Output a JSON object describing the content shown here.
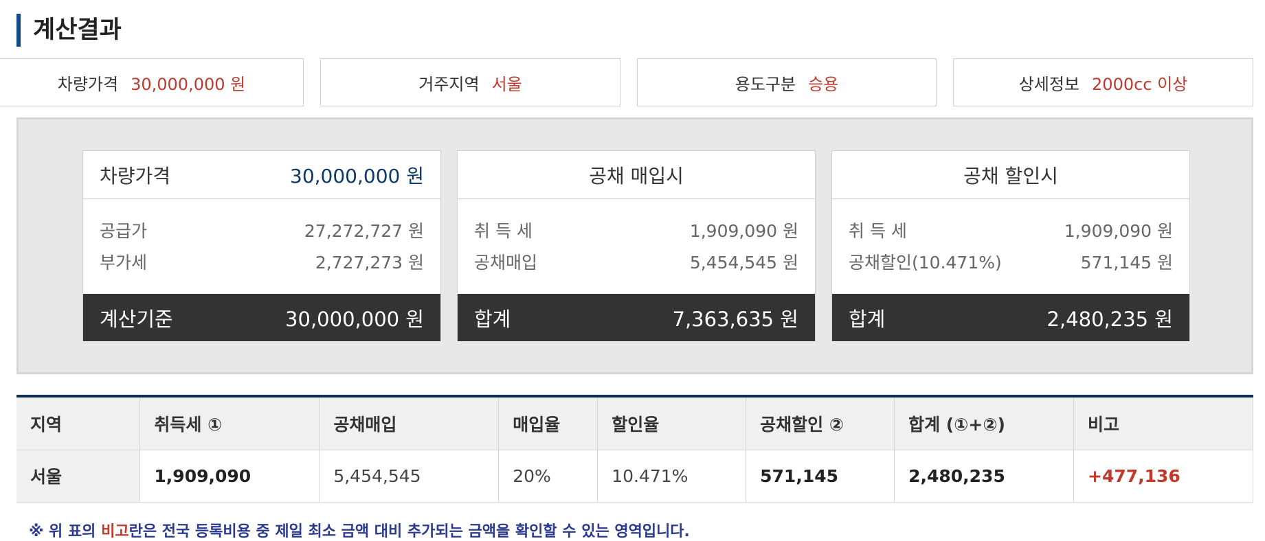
{
  "page": {
    "title": "계산결과"
  },
  "summary": [
    {
      "label": "차량가격",
      "value": "30,000,000 원"
    },
    {
      "label": "거주지역",
      "value": "서울"
    },
    {
      "label": "용도구분",
      "value": "승용"
    },
    {
      "label": "상세정보",
      "value": "2000cc 이상"
    }
  ],
  "cards": {
    "price": {
      "header_label": "차량가격",
      "header_value": "30,000,000 원",
      "lines": [
        {
          "label": "공급가",
          "value": "27,272,727 원"
        },
        {
          "label": "부가세",
          "value": "2,727,273 원"
        }
      ],
      "footer_label": "계산기준",
      "footer_value": "30,000,000 원"
    },
    "purchase": {
      "header_label": "공채 매입시",
      "lines": [
        {
          "label": "취 득 세",
          "value": "1,909,090 원"
        },
        {
          "label": "공채매입",
          "value": "5,454,545 원"
        }
      ],
      "footer_label": "합계",
      "footer_value": "7,363,635 원"
    },
    "discount": {
      "header_label": "공채 할인시",
      "lines": [
        {
          "label": "취 득 세",
          "value": "1,909,090 원"
        },
        {
          "label": "공채할인(10.471%)",
          "value": "571,145 원"
        }
      ],
      "footer_label": "합계",
      "footer_value": "2,480,235 원"
    }
  },
  "table": {
    "headers": [
      "지역",
      "취득세 ①",
      "공채매입",
      "매입율",
      "할인율",
      "공채할인 ②",
      "합계 (①+②)",
      "비고"
    ],
    "rows": [
      [
        "서울",
        "1,909,090",
        "5,454,545",
        "20%",
        "10.471%",
        "571,145",
        "2,480,235",
        "+477,136"
      ]
    ]
  },
  "footnote": {
    "prefix": "※ 위 표의 ",
    "highlight": "비고",
    "suffix": "란은 전국 등록비용 중 제일 최소 금액 대비 추가되는 금액을 확인할 수 있는 영역입니다."
  },
  "colors": {
    "accent_red": "#c0392b",
    "navy": "#0d2f55",
    "dark_footer": "#333333"
  }
}
